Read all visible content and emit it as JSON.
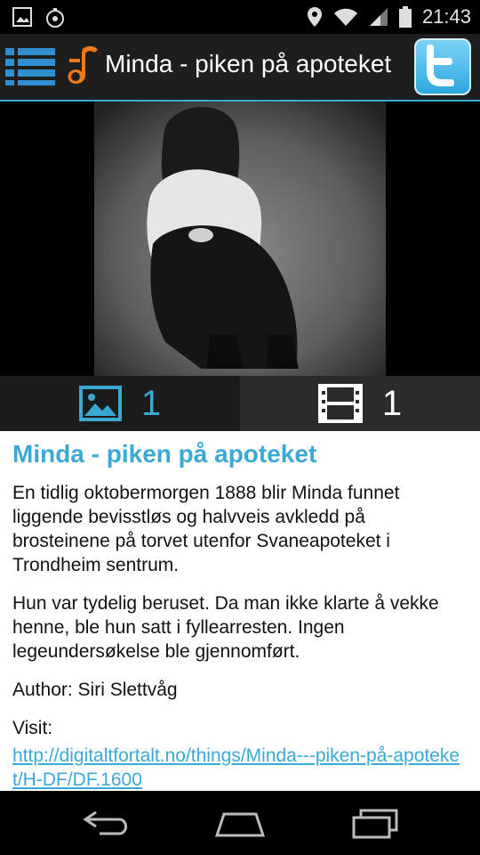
{
  "status_bar": {
    "time": "21:43"
  },
  "app_bar": {
    "title": "Minda - piken på apoteket"
  },
  "media": {
    "image_count": "1",
    "video_count": "1"
  },
  "article": {
    "title": "Minda - piken på apoteket",
    "paragraph1": "En tidlig oktobermorgen 1888 blir Minda funnet liggende bevisstløs og halvveis avkledd på brosteinene på torvet utenfor Svaneapoteket i Trondheim sentrum.",
    "paragraph2": "Hun var tydelig beruset. Da man ikke klarte å vekke henne, ble hun satt i fyllearresten. Ingen legeundersøkelse ble gjennomført.",
    "author": "Author: Siri Slettvåg",
    "visit_label": "Visit:",
    "visit_link": "http://digitaltfortalt.no/things/Minda---piken-på-apoteket/H-DF/DF.1600"
  }
}
